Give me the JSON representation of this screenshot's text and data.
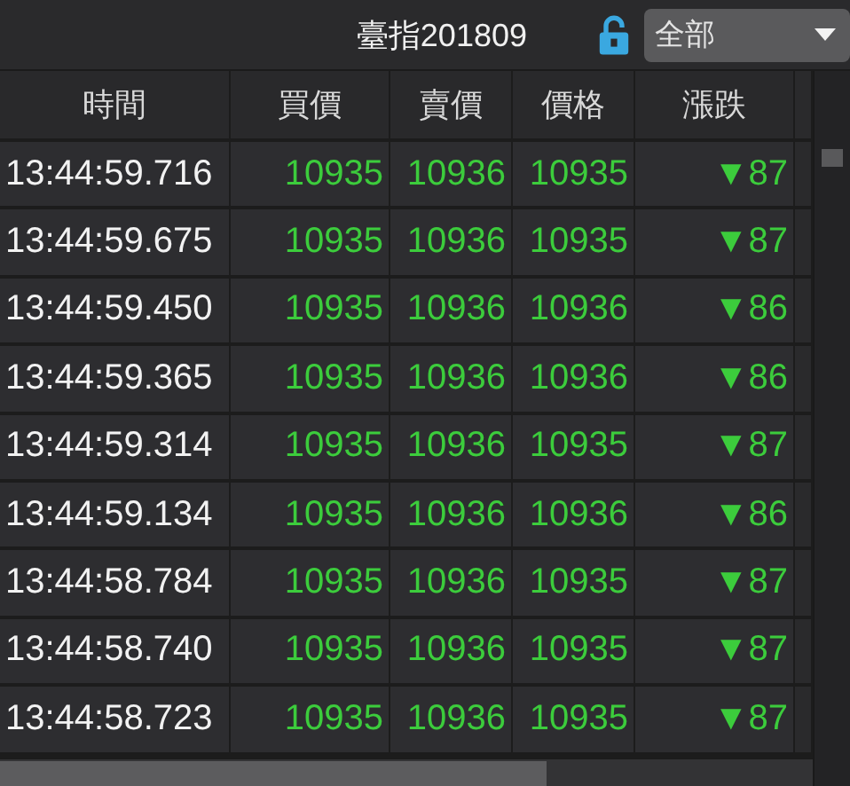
{
  "title": "臺指201809",
  "locked": false,
  "filter": {
    "value": "全部"
  },
  "table": {
    "columns": [
      "時間",
      "買價",
      "賣價",
      "價格",
      "漲跌"
    ],
    "rows": [
      {
        "time": "13:44:59.716",
        "bid": "10935",
        "ask": "10936",
        "price": "10935",
        "change": "▼87"
      },
      {
        "time": "13:44:59.675",
        "bid": "10935",
        "ask": "10936",
        "price": "10935",
        "change": "▼87"
      },
      {
        "time": "13:44:59.450",
        "bid": "10935",
        "ask": "10936",
        "price": "10936",
        "change": "▼86"
      },
      {
        "time": "13:44:59.365",
        "bid": "10935",
        "ask": "10936",
        "price": "10936",
        "change": "▼86"
      },
      {
        "time": "13:44:59.314",
        "bid": "10935",
        "ask": "10936",
        "price": "10935",
        "change": "▼87"
      },
      {
        "time": "13:44:59.134",
        "bid": "10935",
        "ask": "10936",
        "price": "10936",
        "change": "▼86"
      },
      {
        "time": "13:44:58.784",
        "bid": "10935",
        "ask": "10936",
        "price": "10935",
        "change": "▼87"
      },
      {
        "time": "13:44:58.740",
        "bid": "10935",
        "ask": "10936",
        "price": "10935",
        "change": "▼87"
      },
      {
        "time": "13:44:58.723",
        "bid": "10935",
        "ask": "10936",
        "price": "10935",
        "change": "▼87"
      }
    ]
  }
}
